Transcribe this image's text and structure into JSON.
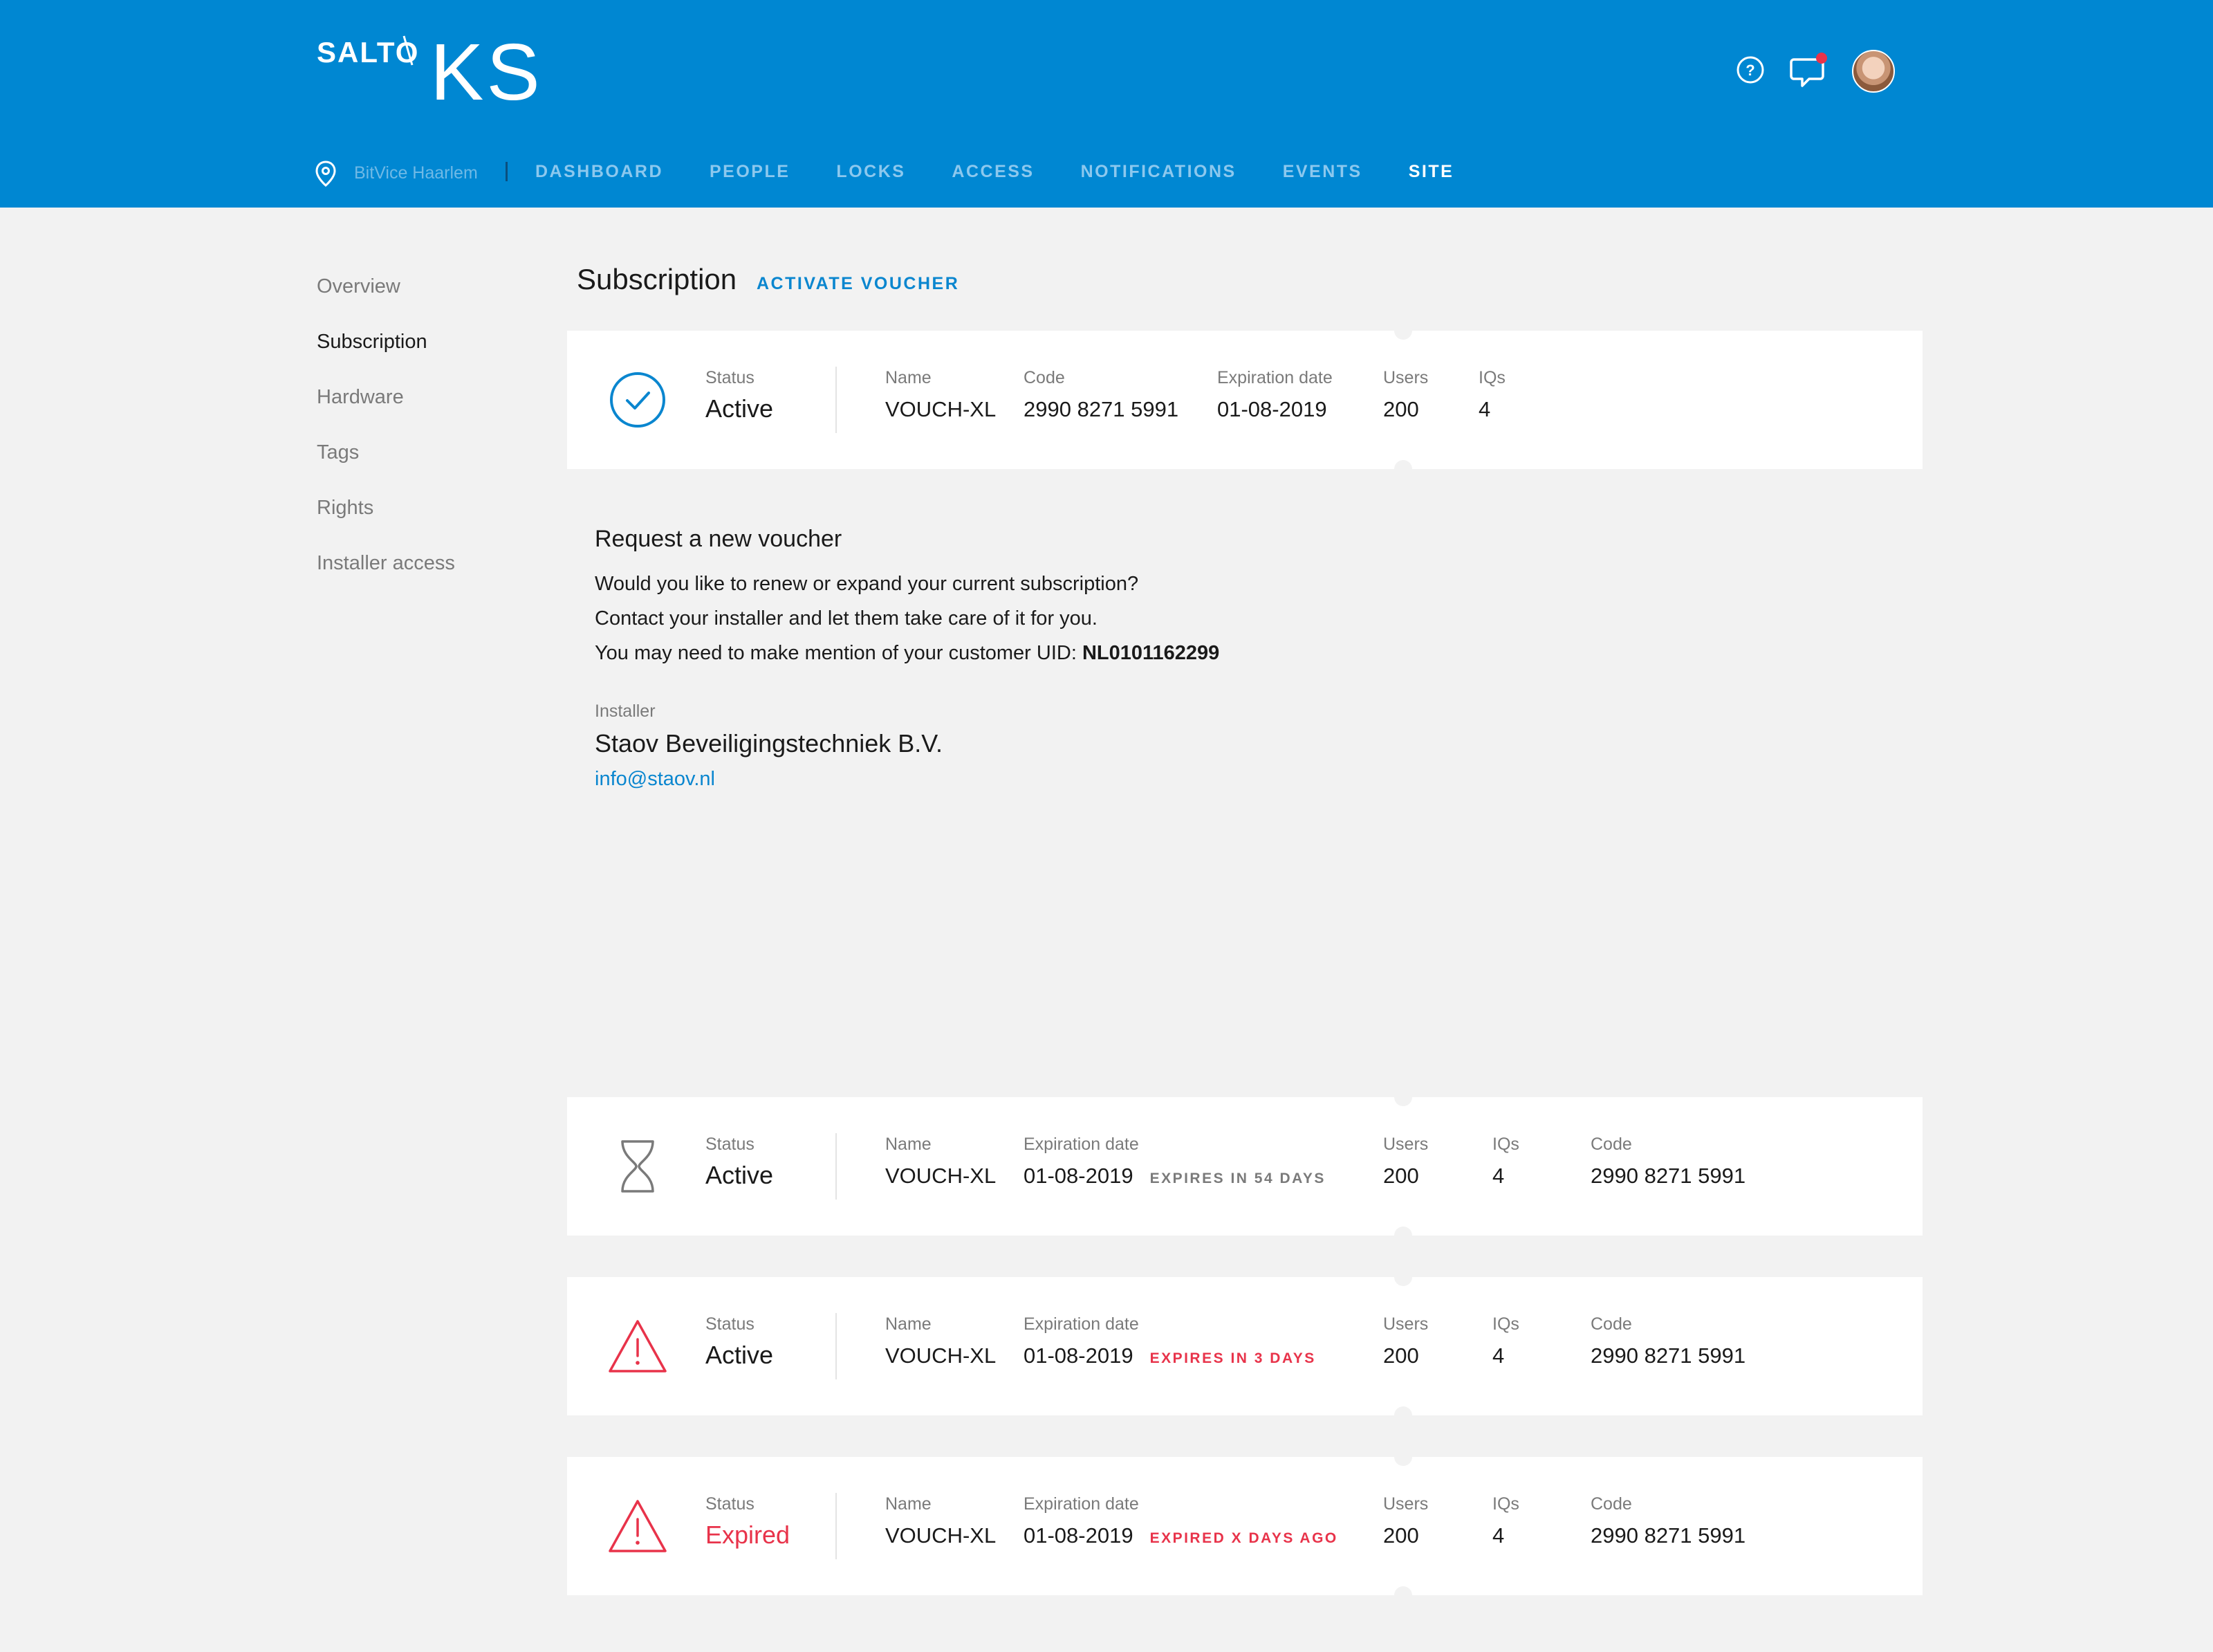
{
  "header": {
    "logo_brand": "SALTO",
    "logo_product": "KS",
    "site_name": "BitVice Haarlem",
    "nav": [
      {
        "label": "DASHBOARD"
      },
      {
        "label": "PEOPLE"
      },
      {
        "label": "LOCKS"
      },
      {
        "label": "ACCESS"
      },
      {
        "label": "NOTIFICATIONS"
      },
      {
        "label": "EVENTS"
      },
      {
        "label": "SITE",
        "active": true
      }
    ],
    "icons": [
      "help-icon",
      "chat-icon",
      "avatar"
    ]
  },
  "sidebar": {
    "items": [
      {
        "label": "Overview"
      },
      {
        "label": "Subscription",
        "active": true
      },
      {
        "label": "Hardware"
      },
      {
        "label": "Tags"
      },
      {
        "label": "Rights"
      },
      {
        "label": "Installer access"
      }
    ]
  },
  "page": {
    "title": "Subscription",
    "activate_label": "ACTIVATE VOUCHER"
  },
  "labels": {
    "status": "Status",
    "name": "Name",
    "code": "Code",
    "expiration": "Expiration date",
    "users": "Users",
    "iqs": "IQs"
  },
  "current": {
    "icon": "check-circle-icon",
    "status": "Active",
    "name": "VOUCH-XL",
    "code": "2990 8271 5991",
    "expiration": "01-08-2019",
    "users": "200",
    "iqs": "4"
  },
  "request": {
    "title": "Request a new voucher",
    "line1": "Would you like to renew or expand your current subscription?",
    "line2": "Contact your installer and let them take care of it for you.",
    "line3_prefix": "You may need to make mention of your customer UID: ",
    "customer_uid": "NL0101162299",
    "installer_label": "Installer",
    "installer_name": "Staov Beveiligingstechniek B.V.",
    "installer_email": "info@staov.nl"
  },
  "variants": [
    {
      "icon": "hourglass-icon",
      "status": "Active",
      "name": "VOUCH-XL",
      "expiration": "01-08-2019",
      "note": "EXPIRES IN 54 DAYS",
      "users": "200",
      "iqs": "4",
      "code": "2990 8271 5991"
    },
    {
      "icon": "warning-icon",
      "status": "Active",
      "name": "VOUCH-XL",
      "expiration": "01-08-2019",
      "note": "EXPIRES IN 3 DAYS",
      "users": "200",
      "iqs": "4",
      "code": "2990 8271 5991"
    },
    {
      "icon": "warning-icon",
      "status": "Expired",
      "name": "VOUCH-XL",
      "expiration": "01-08-2019",
      "note": "EXPIRED X DAYS AGO",
      "users": "200",
      "iqs": "4",
      "code": "2990 8271 5991"
    }
  ],
  "colors": {
    "header_bg": "#0087d2",
    "accent": "#0a86cf",
    "danger": "#e8334a",
    "page_bg": "#f2f2f2"
  }
}
